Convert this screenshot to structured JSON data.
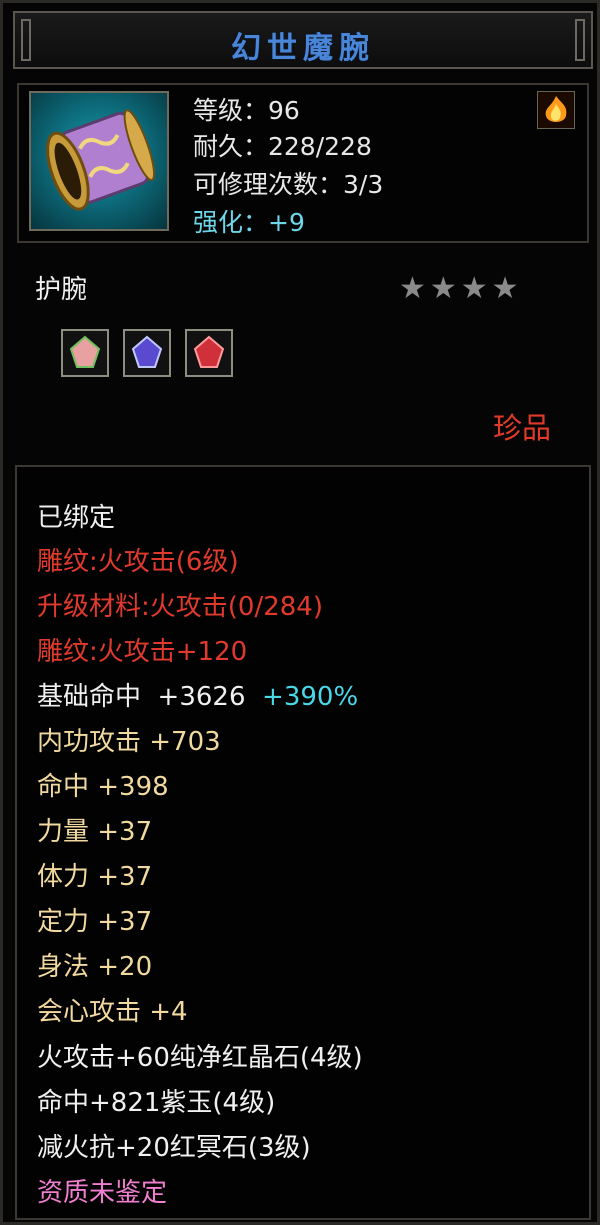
{
  "window": {
    "title": "幻世魔腕"
  },
  "item": {
    "level": "等级：96",
    "durability": "耐久：228/228",
    "repair": "可修理次数：3/3",
    "enhance": "强化：+9",
    "type": "护腕",
    "stars": "★★★★",
    "rarity": "珍品",
    "icon": "bracer-icon",
    "gems": [
      "ruby-gem-icon",
      "amethyst-gem-icon",
      "red-crystal-gem-icon"
    ]
  },
  "attributes": {
    "bound": "已绑定",
    "engrave1": "雕纹:火攻击(6级)",
    "upgrade_material": "升级材料:火攻击(0/284)",
    "engrave2": "雕纹:火攻击+120",
    "base_hit_label": "基础命中",
    "base_hit_value": "+3626",
    "base_hit_pct": "+390%",
    "inner_attack": "内功攻击  +703",
    "hit": "命中  +398",
    "strength": "力量  +37",
    "stamina": "体力  +37",
    "focus": "定力  +37",
    "agility": "身法  +20",
    "crit": "会心攻击  +4",
    "gem1": "火攻击+60纯净红晶石(4级)",
    "gem2": "命中+821紫玉(4级)",
    "gem3": "减火抗+20红冥石(3级)",
    "quality": "资质未鉴定"
  },
  "colors": {
    "title": "#4a86d8",
    "rarity": "#e23a2a",
    "stat": "#f2d9a0",
    "engrave": "#e03a2e",
    "percent": "#49d8e8",
    "quality": "#f07fd0"
  }
}
